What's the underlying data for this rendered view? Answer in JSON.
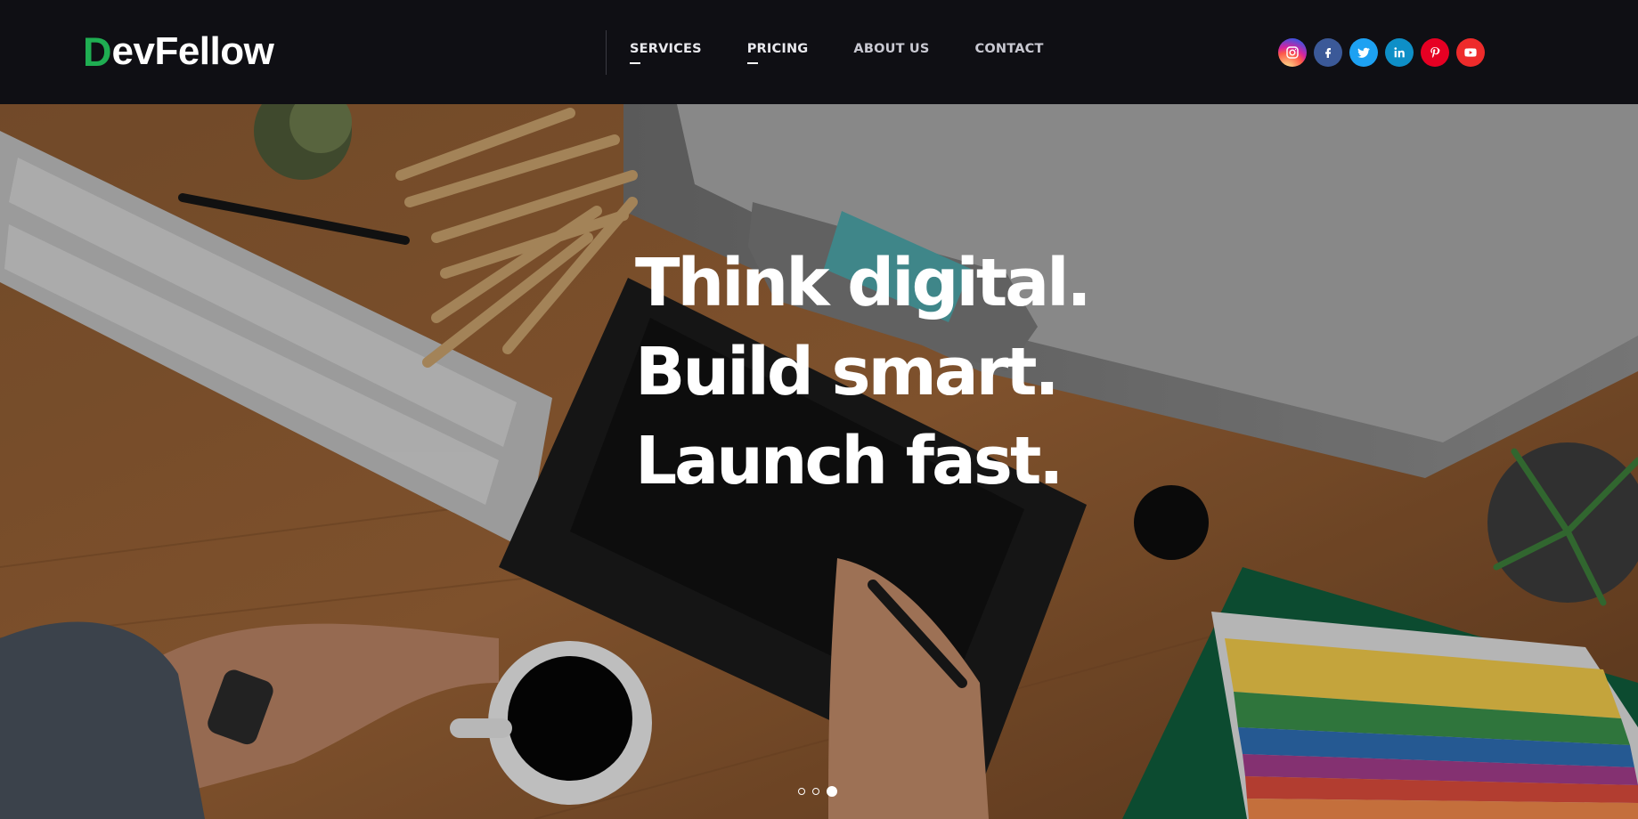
{
  "brand": {
    "logo_mark": "D",
    "logo_text": "evFellow",
    "accent_color": "#1fae52"
  },
  "nav": {
    "items": [
      {
        "label": "SERVICES",
        "active": true
      },
      {
        "label": "PRICING",
        "active": true
      },
      {
        "label": "ABOUT US",
        "active": false
      },
      {
        "label": "CONTACT",
        "active": false
      }
    ]
  },
  "social": [
    {
      "icon": "instagram-icon",
      "color": "#c13584"
    },
    {
      "icon": "facebook-icon",
      "color": "#3b5998"
    },
    {
      "icon": "twitter-icon",
      "color": "#1da1f2"
    },
    {
      "icon": "linkedin-icon",
      "color": "#0e8fc7"
    },
    {
      "icon": "pinterest-icon",
      "color": "#e60023"
    },
    {
      "icon": "youtube-icon",
      "color": "#ee2b2b"
    }
  ],
  "hero": {
    "lines": [
      "Think digital.",
      "Build smart.",
      "Launch fast."
    ],
    "slides": 3,
    "active_slide": 3
  }
}
